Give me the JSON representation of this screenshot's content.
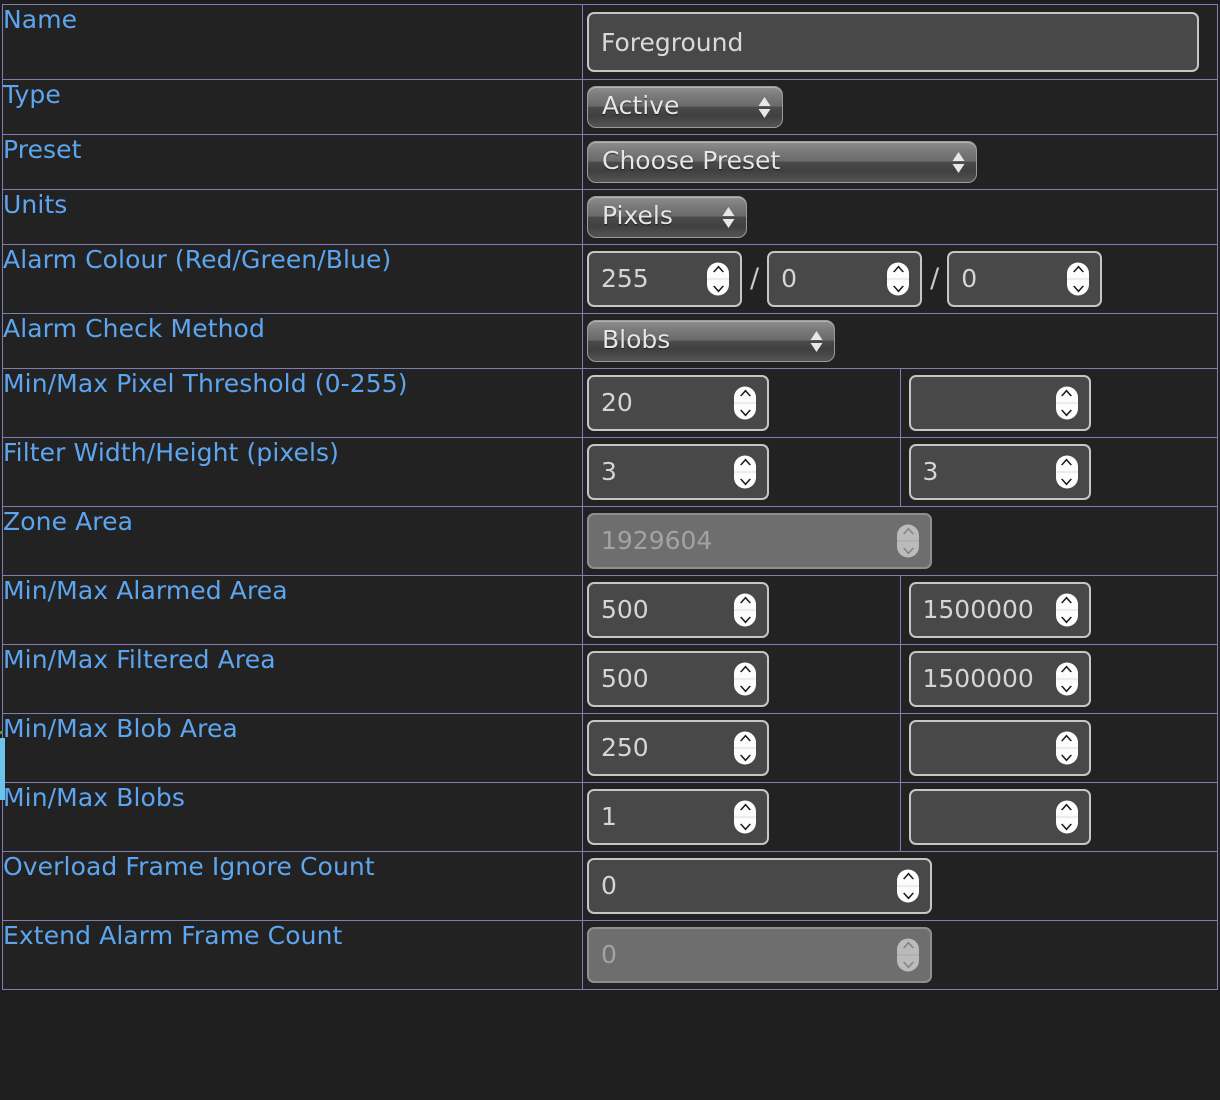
{
  "colors": {
    "label_blue": "#5da5ef",
    "table_border": "#7e7eb4",
    "cell_background": "#222222",
    "input_background": "#484848",
    "input_border": "#c6c6c6",
    "disabled_background": "#6e6e6e",
    "edge_indicator": "#6ec3ea"
  },
  "rows": {
    "name": {
      "label": "Name",
      "value": "Foreground"
    },
    "type": {
      "label": "Type",
      "value": "Active"
    },
    "preset": {
      "label": "Preset",
      "value": "Choose Preset"
    },
    "units": {
      "label": "Units",
      "value": "Pixels"
    },
    "alarm_colour": {
      "label": "Alarm Colour (Red/Green/Blue)",
      "red": "255",
      "separator1": "/",
      "green": "0",
      "separator2": "/",
      "blue": "0"
    },
    "alarm_check_method": {
      "label": "Alarm Check Method",
      "value": "Blobs"
    },
    "pixel_threshold": {
      "label": "Min/Max Pixel Threshold (0-255)",
      "min": "20",
      "max": ""
    },
    "filter_size": {
      "label": "Filter Width/Height (pixels)",
      "min": "3",
      "max": "3"
    },
    "zone_area": {
      "label": "Zone Area",
      "value": "1929604"
    },
    "alarmed_area": {
      "label": "Min/Max Alarmed Area",
      "min": "500",
      "max": "1500000"
    },
    "filtered_area": {
      "label": "Min/Max Filtered Area",
      "min": "500",
      "max": "1500000"
    },
    "blob_area": {
      "label": "Min/Max Blob Area",
      "min": "250",
      "max": ""
    },
    "blobs": {
      "label": "Min/Max Blobs",
      "min": "1",
      "max": ""
    },
    "overload_frame_ignore_count": {
      "label": "Overload Frame Ignore Count",
      "value": "0"
    },
    "extend_alarm_frame_count": {
      "label": "Extend Alarm Frame Count",
      "value": "0"
    }
  }
}
